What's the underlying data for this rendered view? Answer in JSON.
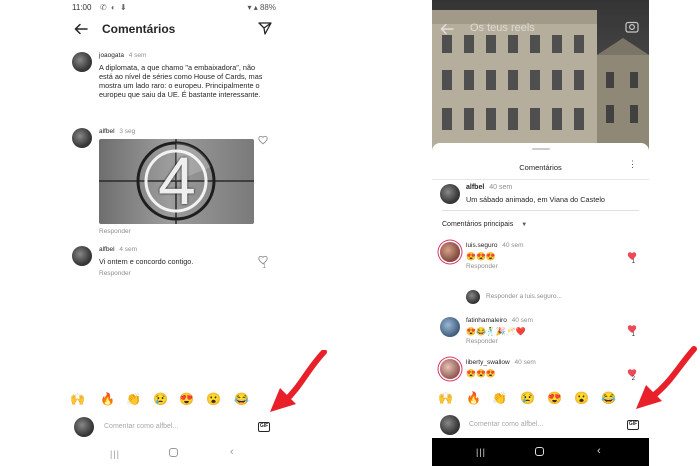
{
  "left": {
    "status": {
      "time": "11:00",
      "battery": "88%"
    },
    "header": {
      "title": "Comentários"
    },
    "comments": [
      {
        "user": "joaogata",
        "time": "4 sem",
        "text": "A diplomata, a que chamo \"a embaixadora\", não está ao nível de séries como House of Cards, mas mostra um lado raro: o europeu. Principalmente o europeu que saiu da UE. É bastante interessante."
      },
      {
        "user": "alfbel",
        "time": "3 seg",
        "gif_text": "4",
        "reply": "Responder"
      },
      {
        "user": "alfbel",
        "time": "4 sem",
        "text": "Vi ontem e concordo contigo.",
        "reply": "Responder",
        "likes": "1"
      }
    ],
    "emojis": [
      "🙌",
      "🔥",
      "👏",
      "😢",
      "😍",
      "😮",
      "😂"
    ],
    "input": {
      "placeholder": "Comentar como alfbel..."
    },
    "gif_label": "GIF",
    "nav": {
      "recent": "|||"
    }
  },
  "right": {
    "header": {
      "title": "Os teus reels"
    },
    "sheet": {
      "title": "Comentários",
      "more": "⋮",
      "caption": {
        "user": "alfbel",
        "time": "40 sem",
        "text": "Um sábado animado, em Viana do Castelo"
      },
      "filter": "Comentários principais",
      "comments": [
        {
          "user": "luis.seguro",
          "time": "40 sem",
          "text": "😍😍😍",
          "reply": "Responder",
          "likes": "1"
        },
        {
          "reply_to": "Responder a luis.seguro..."
        },
        {
          "user": "fatinhamaleiro",
          "time": "40 sem",
          "text": "😍😂🕺🎉🥂❤️",
          "reply": "Responder",
          "likes": "1"
        },
        {
          "user": "liberty_swallow",
          "time": "40 sem",
          "text": "😍😍😍",
          "likes": "2"
        }
      ]
    },
    "emojis": [
      "🙌",
      "🔥",
      "👏",
      "😢",
      "😍",
      "😮",
      "😂"
    ],
    "input": {
      "placeholder": "Comentar como alfbel..."
    },
    "gif_label": "GIF",
    "nav": {
      "recent": "|||"
    }
  },
  "colors": {
    "heart_red": "#ed4956",
    "arrow_red": "#e8202a",
    "text": "#262626",
    "muted": "#8e8e8e"
  }
}
